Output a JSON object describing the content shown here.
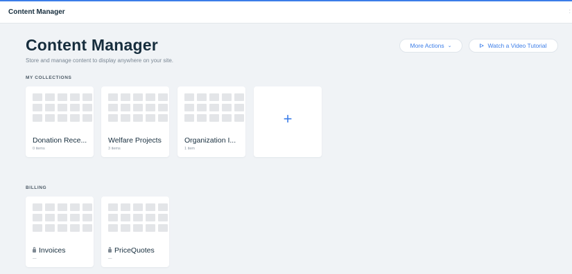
{
  "window": {
    "title": "Content Manager"
  },
  "header": {
    "title": "Content Manager",
    "subtitle": "Store and manage content to display anywhere on your site.",
    "more_actions_label": "More Actions",
    "video_tutorial_label": "Watch a Video Tutorial"
  },
  "sections": {
    "my_collections": {
      "label": "MY COLLECTIONS",
      "items": [
        {
          "name": "Donation Rece...",
          "count": "0 items"
        },
        {
          "name": "Welfare Projects",
          "count": "3 items"
        },
        {
          "name": "Organization I...",
          "count": "1 item"
        }
      ],
      "add_symbol": "+"
    },
    "billing": {
      "label": "BILLING",
      "items": [
        {
          "name": "Invoices",
          "count": "—"
        },
        {
          "name": "PriceQuotes",
          "count": "—"
        }
      ]
    }
  },
  "icons": {
    "more_actions": "chevron-down-icon",
    "video_tutorial": "play-icon",
    "locked_collection": "lock-icon",
    "add_collection": "plus-icon"
  },
  "colors": {
    "accent": "#3b7de8",
    "background": "#f0f3f6",
    "card": "#ffffff",
    "text": "#162d3d"
  }
}
